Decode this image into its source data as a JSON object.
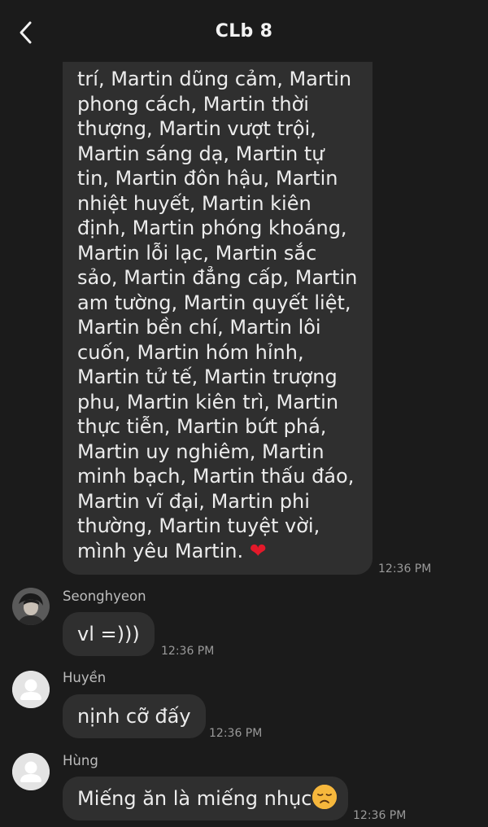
{
  "header": {
    "title": "CLb 8"
  },
  "messages": {
    "long_text": "trí, Martin dũng cảm, Martin\nphong cách, Martin thời\nthượng, Martin vượt trội,\nMartin sáng dạ, Martin tự\ntin, Martin đôn hậu, Martin\nnhiệt huyết, Martin kiên\nđịnh, Martin phóng khoáng,\nMartin lỗi lạc, Martin sắc\nsảo, Martin đẳng cấp, Martin\nam tường, Martin quyết liệt,\nMartin bền chí, Martin lôi\ncuốn, Martin hóm hỉnh,\nMartin tử tế, Martin trượng\nphu, Martin kiên trì, Martin\nthực tiễn, Martin bứt phá,\nMartin uy nghiêm, Martin\nminh bạch, Martin thấu đáo,\nMartin vĩ đại, Martin phi\nthường, Martin tuyệt vời,\nmình yêu Martin. ",
    "long_heart": "❤",
    "long_time": "12:36 PM",
    "m1_sender": "Seonghyeon",
    "m1_text": "vl  =)))",
    "m1_time": "12:36 PM",
    "m2_sender": "Huyền",
    "m2_text": "nịnh cỡ đấy",
    "m2_time": "12:36 PM",
    "m3_sender": "Hùng",
    "m3_text": "Miếng ăn là miếng nhục",
    "m3_time": "12:36 PM"
  },
  "icons": {
    "back": "chevron-left-icon",
    "heart": "red-heart-emoji",
    "sad": "disappointed-face-emoji"
  }
}
